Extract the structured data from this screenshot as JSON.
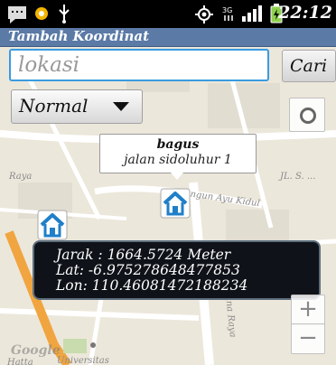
{
  "status_bar": {
    "time": "22:12",
    "icons": [
      "chat-icon",
      "notification-dot-icon",
      "usb-icon",
      "gps-icon",
      "network-3g-icon",
      "signal-icon",
      "battery-icon"
    ]
  },
  "title_bar": {
    "title": "Tambah Koordinat"
  },
  "search": {
    "placeholder": "lokasi",
    "button_label": "Cari"
  },
  "map_type": {
    "selected": "Normal"
  },
  "marker_callout": {
    "title": "bagus",
    "snippet": "jalan sidoluhur 1"
  },
  "info_box": {
    "jarak": "Jarak : 1664.5724 Meter",
    "lat": "Lat: -6.975278648477853",
    "lon": "Lon: 110.46081472188234"
  },
  "zoom": {
    "in_label": "+",
    "out_label": "−"
  },
  "map_labels": {
    "road_1": "Raya",
    "road_2": "Bangun Ayu Kidul",
    "road_3": "Hatta",
    "road_4": "Arjuna Raya",
    "road_5": "Universitas",
    "google": "Google",
    "place_1": "JL. S. ..."
  },
  "colors": {
    "title_bar": "#5b7aa6",
    "search_border": "#3a9be0",
    "info_box": "#0f1319",
    "road_orange": "#f0a540"
  }
}
